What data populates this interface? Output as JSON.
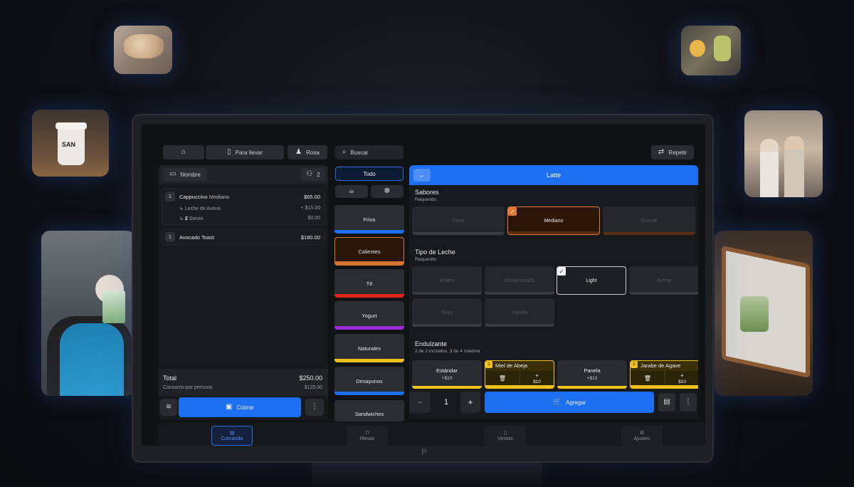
{
  "photos": {
    "cup_text": "SAN"
  },
  "topbar": {
    "para_llevar": "Para llevar",
    "user": "Rosa",
    "search_placeholder": "Buscar",
    "repeat": "Repetir"
  },
  "order": {
    "name_btn": "Nombre",
    "guests": "2",
    "items": [
      {
        "qty": "1",
        "name": "Cappuccino",
        "size": "Mediano",
        "price": "$65.00",
        "mods": [
          {
            "qty": "",
            "label": "Leche de Avena",
            "price": "+ $15.00"
          },
          {
            "qty": "2",
            "label": "Stevia",
            "price": "$0.00"
          }
        ]
      },
      {
        "qty": "1",
        "name": "Avocado Toast",
        "price": "$180.00"
      }
    ],
    "total_label": "Total",
    "total": "$250.00",
    "per_person_label": "Consumo por persona",
    "per_person": "$125.00",
    "charge": "Cobrar"
  },
  "categories": {
    "all": "Todo",
    "items": [
      {
        "label": "Fríos",
        "color": "#1d6ff2"
      },
      {
        "label": "Calientes",
        "color": "#d6732e",
        "selected": true
      },
      {
        "label": "Té",
        "color": "#e0241d"
      },
      {
        "label": "Yogurt",
        "color": "#9b2ad8"
      },
      {
        "label": "Naturales",
        "color": "#f0c01d"
      },
      {
        "label": "Desayunos",
        "color": "#1d6ff2"
      },
      {
        "label": "Sandwiches",
        "color": "#2b2d32"
      }
    ]
  },
  "product": {
    "title": "Latte",
    "flavors": {
      "title": "Sabores",
      "sub": "Requerido",
      "options": [
        "Chico",
        "Mediano",
        "Grande"
      ],
      "selected": "Mediano"
    },
    "milk": {
      "title": "Tipo de Leche",
      "sub": "Requerido",
      "options": [
        "Entera",
        "Deslactosada",
        "Light",
        "Avena",
        "Soya",
        "Vainilla"
      ],
      "selected": "Light"
    },
    "sweetener": {
      "title": "Endulzante",
      "sub": "2 de 2 incluidos, 3 de 4 máximo",
      "options": [
        {
          "name": "Estándar",
          "price": "+$10",
          "selected": false,
          "count": ""
        },
        {
          "name": "Miel de Abeja",
          "price": "$10",
          "selected": true,
          "count": "1"
        },
        {
          "name": "Panela",
          "price": "+$10",
          "selected": false,
          "count": ""
        },
        {
          "name": "Jarabe de Agave",
          "price": "$10",
          "selected": true,
          "count": "2"
        }
      ]
    },
    "quantity": "1",
    "add": "Agregar"
  },
  "nav": {
    "items": [
      "Comanda",
      "Mesas",
      "Ventas",
      "Ajustes"
    ],
    "active": "Comanda"
  },
  "colors": {
    "accent": "#1d6ff2",
    "orange": "#d6732e",
    "yellow": "#f0c01d"
  }
}
